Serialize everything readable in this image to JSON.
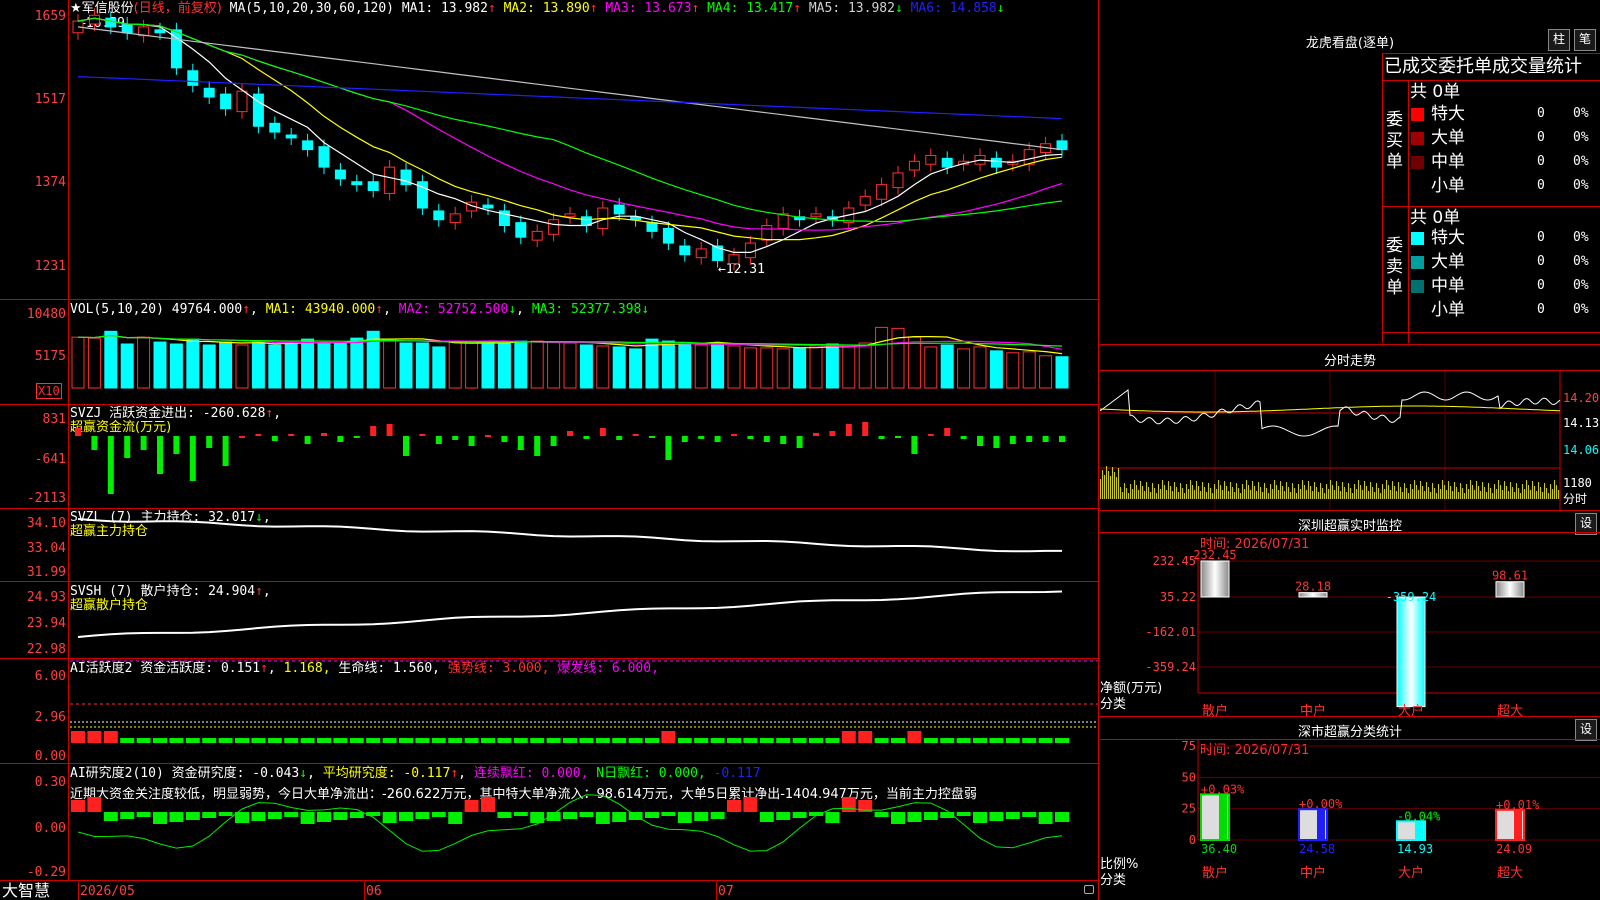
{
  "chart_header": {
    "stock_name": "★军信股份",
    "mode": "(日线，前复权)",
    "ma_text": "MA(5,10,20,30,60,120)",
    "ma": [
      {
        "label": "MA1:",
        "value": "13.982",
        "arrow": "↑",
        "color": "#ffffff"
      },
      {
        "label": "MA2:",
        "value": "13.890",
        "arrow": "↑",
        "color": "#ffff00"
      },
      {
        "label": "MA3:",
        "value": "13.673",
        "arrow": "↑",
        "color": "#ff00ff"
      },
      {
        "label": "MA4:",
        "value": "13.417",
        "arrow": "↑",
        "color": "#00ff00"
      },
      {
        "label": "MA5:",
        "value": "13.982",
        "arrow": "↓",
        "color": "#d0d0d0"
      },
      {
        "label": "MA6:",
        "value": "14.858",
        "arrow": "↓",
        "color": "#2020ff"
      }
    ],
    "high_marker": "←16.59",
    "low_marker": "←12.31"
  },
  "price_axis": [
    "1659",
    "1517",
    "1374",
    "1231"
  ],
  "vol": {
    "title": "VOL(5,10,20)",
    "value": "49764.000",
    "ma1": "MA1: 43940.000",
    "ma2": "MA2: 52752.500",
    "ma3": "MA3: 52377.398",
    "axis": [
      "10480",
      "5175"
    ],
    "unit": "X10"
  },
  "svzj": {
    "title": "SVZJ  活跃资金进出: -260.628",
    "subtitle": "超赢资金流(万元)",
    "axis": [
      "831",
      "-641",
      "-2113"
    ]
  },
  "svzl": {
    "title": "SVZL (7) 主力持仓: 32.017",
    "subtitle": "超赢主力持仓",
    "axis": [
      "34.10",
      "33.04",
      "31.99"
    ]
  },
  "svsh": {
    "title": "SVSH (7) 散户持仓: 24.904",
    "subtitle": "超赢散户持仓",
    "axis": [
      "24.93",
      "23.94",
      "22.98"
    ]
  },
  "ai_active": {
    "title": "AI活跃度2 资金活跃度: 0.151",
    "v2": "1.168,",
    "life": "生命线: 1.560,",
    "strong": "强势线: 3.000,",
    "burst": "爆发线: 6.000,",
    "axis": [
      "6.00",
      "2.96",
      "0.00"
    ]
  },
  "ai_research": {
    "title": "AI研究度2(10) 资金研究度: -0.043",
    "avg": "平均研究度: -0.117",
    "cont": "连续飘红: 0.000,",
    "nday": "N日飘红: 0.000,",
    "last": "-0.117",
    "note": "近期大资金关注度较低，明显弱势，今日大单净流出：-260.622万元，其中特大单净流入：98.614万元，大单5日累计净出-1404.947万元，当前主力控盘弱",
    "axis": [
      "0.30",
      "0.00",
      "-0.29"
    ]
  },
  "xaxis": {
    "brand": "大智慧",
    "labels": [
      "2026/05",
      "06",
      "07"
    ]
  },
  "dragon": {
    "title": "龙虎看盘(逐单)",
    "btn1": "柱",
    "btn2": "笔",
    "header": "已成交委托单成交量统计",
    "buy_label": "委买单",
    "sell_label": "委卖单",
    "buy_total": "共 0单",
    "sell_total": "共 0单",
    "buy": [
      {
        "name": "特大",
        "count": "0",
        "pct": "0%",
        "color": "#ff0000"
      },
      {
        "name": "大单",
        "count": "0",
        "pct": "0%",
        "color": "#a00000"
      },
      {
        "name": "中单",
        "count": "0",
        "pct": "0%",
        "color": "#700000"
      },
      {
        "name": "小单",
        "count": "0",
        "pct": "0%",
        "color": "#000000"
      }
    ],
    "sell": [
      {
        "name": "特大",
        "count": "0",
        "pct": "0%",
        "color": "#00ffff"
      },
      {
        "name": "大单",
        "count": "0",
        "pct": "0%",
        "color": "#00a0a0"
      },
      {
        "name": "中单",
        "count": "0",
        "pct": "0%",
        "color": "#007070"
      },
      {
        "name": "小单",
        "count": "0",
        "pct": "0%",
        "color": "#000000"
      }
    ]
  },
  "intraday": {
    "title": "分时走势",
    "axis": [
      "14.20",
      "14.13",
      "14.06"
    ],
    "vol_axis": "1180",
    "vol_label": "分时"
  },
  "monitor": {
    "title": "深圳超赢实时监控",
    "set": "设",
    "time": "时间: 2026/07/31",
    "axis": [
      "232.45",
      "35.22",
      "-162.01",
      "-359.24"
    ],
    "ylabel": "净额(万元)",
    "xlabel": "分类",
    "bars": [
      {
        "name": "散户",
        "value": "232.45"
      },
      {
        "name": "中户",
        "value": "28.18"
      },
      {
        "name": "大户",
        "value": "-359.24"
      },
      {
        "name": "超大",
        "value": "98.61"
      }
    ]
  },
  "classify": {
    "title": "深市超赢分类统计",
    "set": "设",
    "time": "时间: 2026/07/31",
    "axis": [
      "75",
      "50",
      "25",
      "0"
    ],
    "ylabel": "比例%",
    "xlabel": "分类",
    "bars": [
      {
        "name": "散户",
        "pct": "36.40",
        "change": "+0.03%",
        "color": "#00dd00"
      },
      {
        "name": "中户",
        "pct": "24.58",
        "change": "+0.00%",
        "color": "#2020ff"
      },
      {
        "name": "大户",
        "pct": "14.93",
        "change": "-0.04%",
        "color": "#00ffff"
      },
      {
        "name": "超大",
        "pct": "24.09",
        "change": "+0.01%",
        "color": "#ff2020"
      }
    ]
  }
}
